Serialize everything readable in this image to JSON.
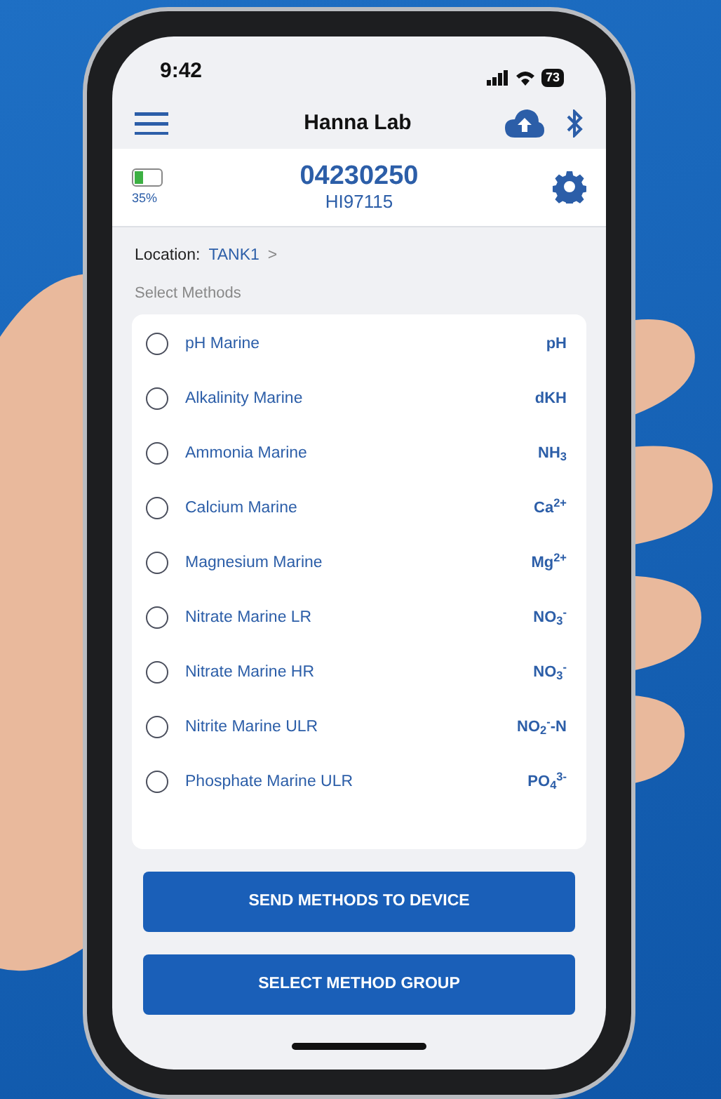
{
  "status_bar": {
    "time": "9:42",
    "battery": "73"
  },
  "header": {
    "title": "Hanna Lab"
  },
  "device": {
    "battery": {
      "level": 0.35,
      "text": "35%"
    },
    "serial": "04230250",
    "model": "HI97115"
  },
  "location": {
    "label": "Location:",
    "value": "TANK1",
    "chevron": ">"
  },
  "section_title": "Select Methods",
  "methods": [
    {
      "name": "pH Marine",
      "unit": "pH",
      "selected": false
    },
    {
      "name": "Alkalinity Marine",
      "unit": "dKH",
      "selected": false
    },
    {
      "name": "Ammonia Marine",
      "unit": "NH$_{3}$",
      "selected": false
    },
    {
      "name": "Calcium Marine",
      "unit": "Ca$^{2+}$",
      "selected": false
    },
    {
      "name": "Magnesium Marine",
      "unit": "Mg$^{2+}$",
      "selected": false
    },
    {
      "name": "Nitrate Marine LR",
      "unit": "NO$_{3}$$^{-}$",
      "selected": false
    },
    {
      "name": "Nitrate Marine HR",
      "unit": "NO$_{3}$$^{-}$",
      "selected": false
    },
    {
      "name": "Nitrite Marine ULR",
      "unit": "NO$_{2}$$^{-}$-N",
      "selected": false
    },
    {
      "name": "Phosphate Marine ULR",
      "unit": "PO$_{4}$$^{3-}$",
      "selected": false
    }
  ],
  "buttons": [
    "SEND METHODS TO DEVICE",
    "SELECT METHOD GROUP"
  ]
}
